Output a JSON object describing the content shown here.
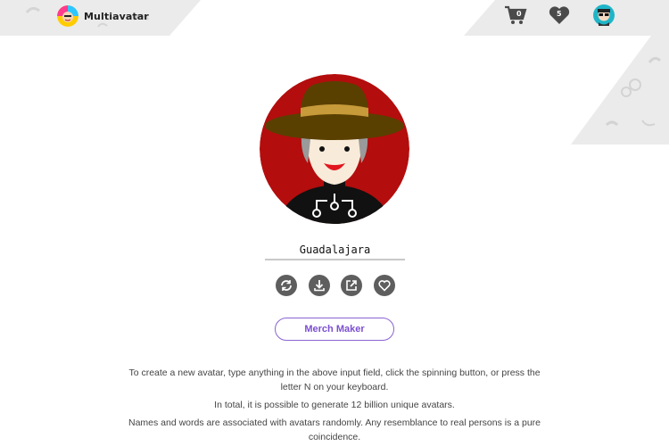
{
  "header": {
    "brand_name": "Multiavatar",
    "cart_count": "0",
    "favorites_count": "5"
  },
  "avatar": {
    "name_value": "Guadalajara"
  },
  "actions": {
    "icons": [
      "refresh-icon",
      "download-icon",
      "external-link-icon",
      "heart-icon"
    ]
  },
  "merch_button_label": "Merch Maker",
  "info": {
    "line1": "To create a new avatar, type anything in the above input field, click the spinning button, or press the letter N on your keyboard.",
    "line2": "In total, it is possible to generate 12 billion unique avatars.",
    "line3": "Names and words are associated with avatars randomly. Any resemblance to real persons is a pure coincidence."
  },
  "colors": {
    "accent": "#7b4fd0",
    "avatar_bg": "#b30d0d",
    "icon_grey": "#5e5e5e",
    "deco_grey": "#e9e9e9"
  }
}
